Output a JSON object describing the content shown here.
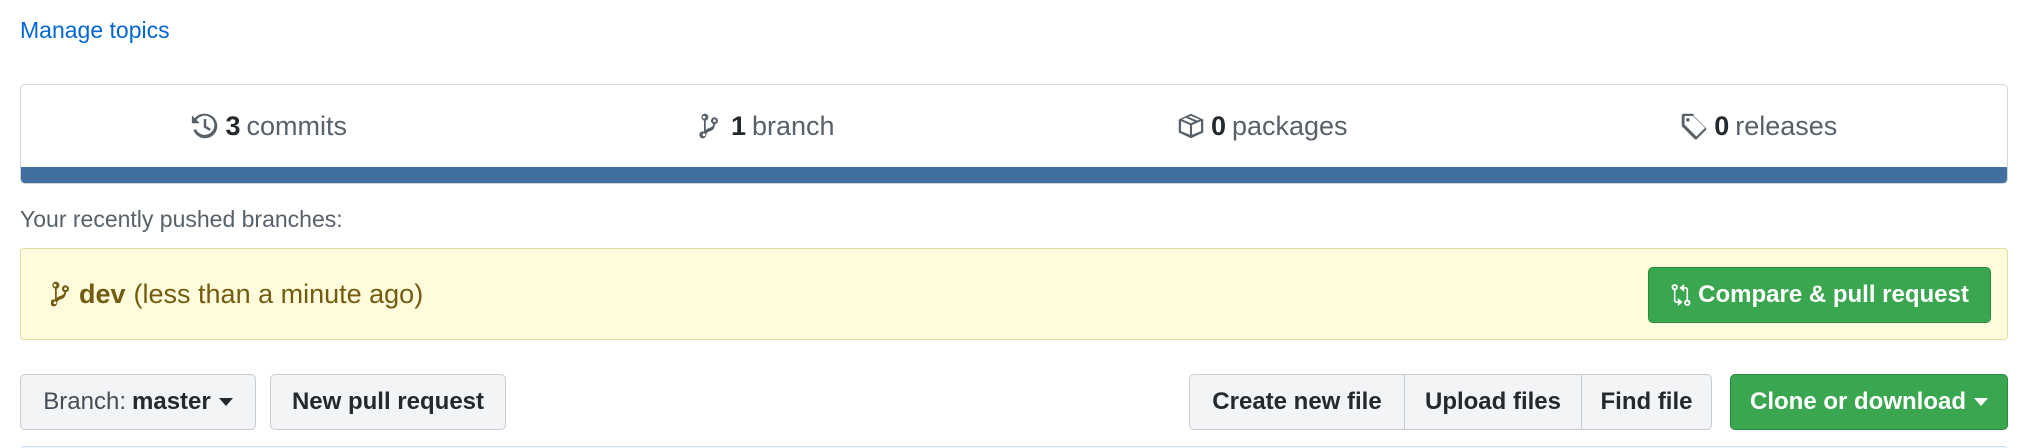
{
  "topics": {
    "manage_label": "Manage topics"
  },
  "summary": {
    "commits": {
      "count": "3",
      "label": "commits",
      "icon": "history-icon"
    },
    "branches": {
      "count": "1",
      "label": "branch",
      "icon": "git-branch-icon"
    },
    "packages": {
      "count": "0",
      "label": "packages",
      "icon": "package-icon"
    },
    "releases": {
      "count": "0",
      "label": "releases",
      "icon": "tag-icon"
    },
    "language_bar_color": "#4170a0"
  },
  "recent": {
    "heading": "Your recently pushed branches:",
    "branch_name": "dev",
    "time_text": "(less than a minute ago)",
    "compare_button": "Compare & pull request"
  },
  "toolbar": {
    "branch_prefix": "Branch:",
    "branch_value": "master",
    "new_pr": "New pull request",
    "create_file": "Create new file",
    "upload_files": "Upload files",
    "find_file": "Find file",
    "clone_download": "Clone or download"
  },
  "colors": {
    "link": "#0366d6",
    "green": "#3aa64f",
    "highlight_bg": "#fffbdd",
    "highlight_text": "#735c0f"
  }
}
